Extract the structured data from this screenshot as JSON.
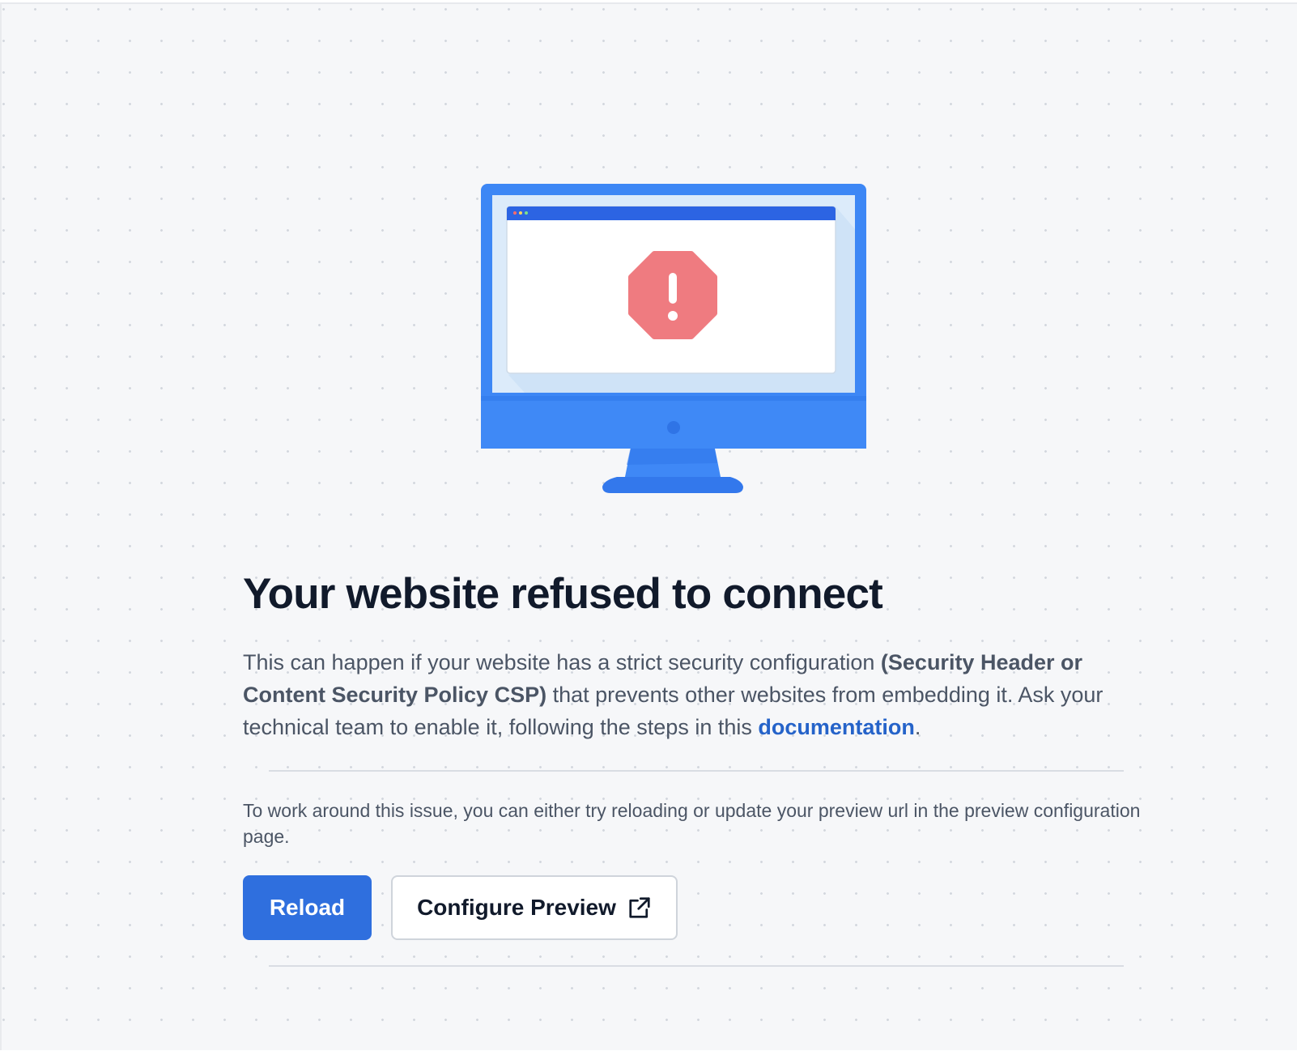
{
  "illustration": {
    "icon": "monitor-error-illustration",
    "badge_icon": "exclamation-octagon-icon",
    "colors": {
      "monitor": "#3d87f5",
      "screen_frame": "#3b82f6",
      "screen_bg": "#dcebfa",
      "window_bar": "#2c64e3",
      "error": "#ef7b80"
    }
  },
  "error": {
    "title": "Your website refused to connect",
    "description": {
      "text_before": "This can happen if your website has a strict security configuration ",
      "strong_text": "(Security Header or Content Security Policy CSP)",
      "text_middle": " that prevents other websites from embedding it. Ask your technical team to enable it, following the steps in this ",
      "link_text": "documentation",
      "text_after": "."
    }
  },
  "workaround": {
    "text": "To work around this issue, you can either try reloading or update your preview url in the preview configuration page."
  },
  "actions": {
    "reload_label": "Reload",
    "configure_label": "Configure Preview",
    "configure_icon": "external-link-icon"
  },
  "colors": {
    "primary": "#2f6fde",
    "link": "#2563c9",
    "title": "#111a2b",
    "body_text": "#4b5565",
    "background": "#f6f7f9"
  }
}
